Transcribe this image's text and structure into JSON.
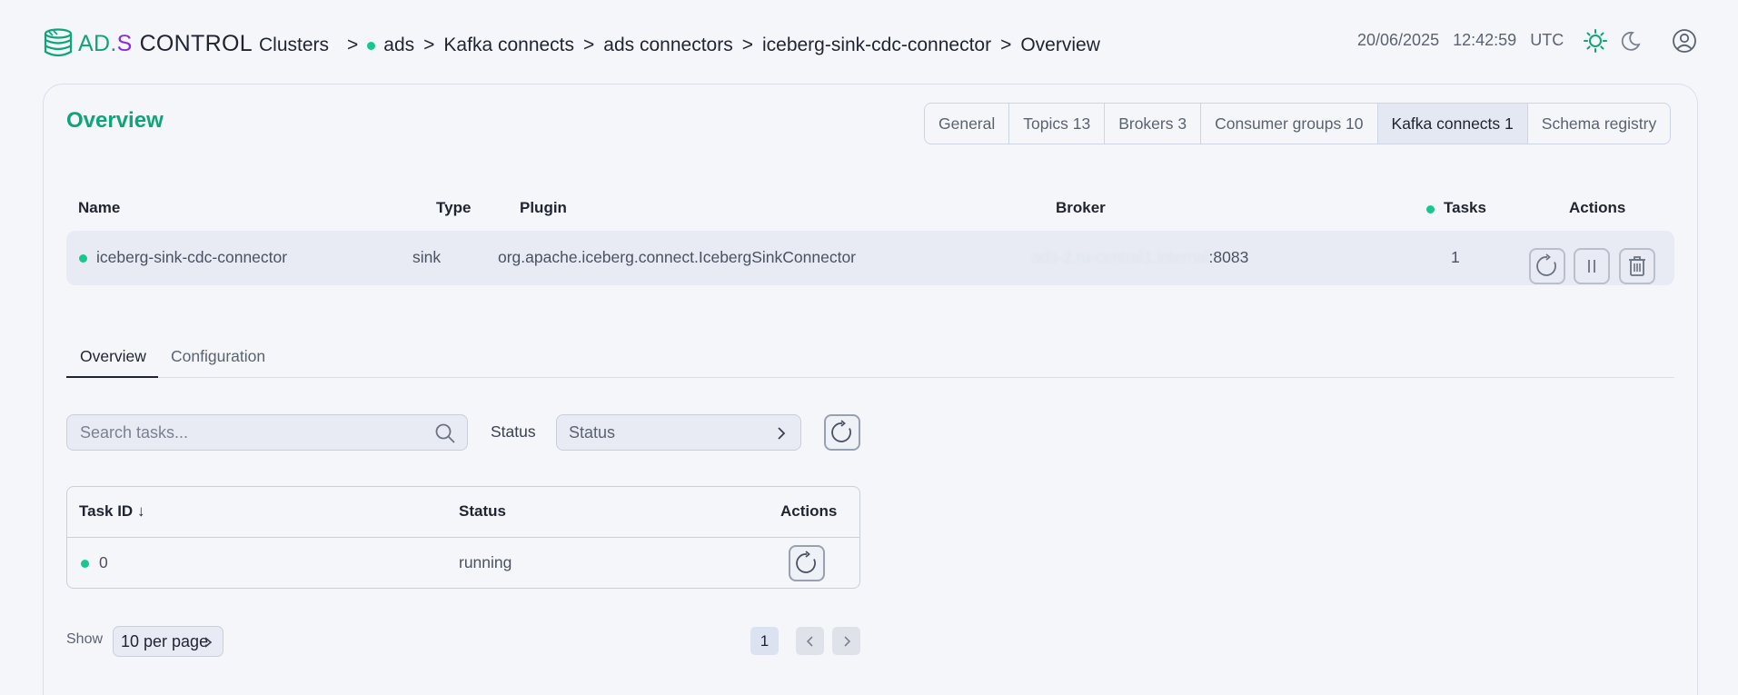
{
  "logo": {
    "ad": "AD",
    "dot": ".",
    "s": "S",
    "control": "CONTROL"
  },
  "breadcrumb": {
    "root": "Clusters",
    "items": [
      "ads",
      "Kafka connects",
      "ads connectors",
      "iceberg-sink-cdc-connector",
      "Overview"
    ],
    "separator": ">"
  },
  "datetime": {
    "date": "20/06/2025",
    "time": "12:42:59",
    "tz": "UTC"
  },
  "page_title": "Overview",
  "cluster_tabs": [
    {
      "label": "General",
      "active": false
    },
    {
      "label": "Topics 13",
      "active": false
    },
    {
      "label": "Brokers 3",
      "active": false
    },
    {
      "label": "Consumer groups 10",
      "active": false
    },
    {
      "label": "Kafka connects 1",
      "active": true
    },
    {
      "label": "Schema registry",
      "active": false
    }
  ],
  "connector_table": {
    "columns": {
      "name": "Name",
      "type": "Type",
      "plugin": "Plugin",
      "broker": "Broker",
      "tasks": "Tasks",
      "actions": "Actions"
    },
    "row": {
      "name": "iceberg-sink-cdc-connector",
      "type": "sink",
      "plugin": "org.apache.iceberg.connect.IcebergSinkConnector",
      "broker_redacted": "ads-2.ru-central1.internal",
      "broker_port": ":8083",
      "tasks": "1",
      "status_color": "#16c78f"
    },
    "actions": [
      "restart-icon",
      "pause-icon",
      "trash-icon"
    ]
  },
  "sub_tabs": [
    {
      "label": "Overview",
      "active": true
    },
    {
      "label": "Configuration",
      "active": false
    }
  ],
  "filters": {
    "search_placeholder": "Search tasks...",
    "status_label": "Status",
    "status_placeholder": "Status"
  },
  "tasks_table": {
    "columns": {
      "id": "Task ID",
      "sort_arrow": "↓",
      "status": "Status",
      "actions": "Actions"
    },
    "rows": [
      {
        "id": "0",
        "status": "running",
        "status_color": "#16c78f"
      }
    ]
  },
  "pagination": {
    "show_label": "Show",
    "per_page": "10 per page",
    "current_page": "1"
  },
  "colors": {
    "accent": "#0fa57a",
    "brand_s": "#8a2be2",
    "status_ok": "#16c78f"
  }
}
